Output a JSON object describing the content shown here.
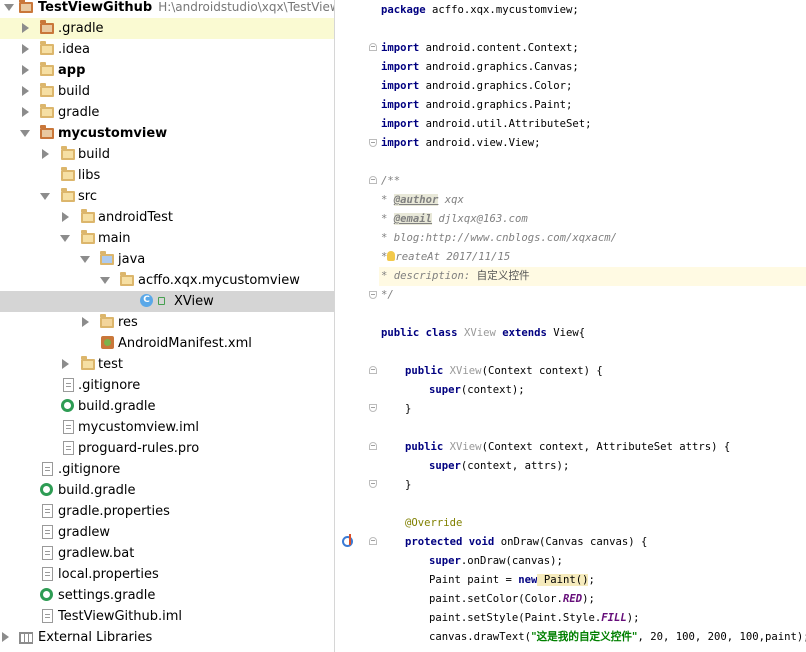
{
  "tree": {
    "root": {
      "label": "TestViewGithub",
      "path": "H:\\androidstudio\\xqx\\TestViewG"
    },
    "items": [
      {
        "label": ".gradle"
      },
      {
        "label": ".idea"
      },
      {
        "label": "app"
      },
      {
        "label": "build"
      },
      {
        "label": "gradle"
      },
      {
        "label": "mycustomview"
      },
      {
        "label": "build"
      },
      {
        "label": "libs"
      },
      {
        "label": "src"
      },
      {
        "label": "androidTest"
      },
      {
        "label": "main"
      },
      {
        "label": "java"
      },
      {
        "label": "acffo.xqx.mycustomview"
      },
      {
        "label": "XView"
      },
      {
        "label": "res"
      },
      {
        "label": "AndroidManifest.xml"
      },
      {
        "label": "test"
      },
      {
        "label": ".gitignore"
      },
      {
        "label": "build.gradle"
      },
      {
        "label": "mycustomview.iml"
      },
      {
        "label": "proguard-rules.pro"
      },
      {
        "label": ".gitignore"
      },
      {
        "label": "build.gradle"
      },
      {
        "label": "gradle.properties"
      },
      {
        "label": "gradlew"
      },
      {
        "label": "gradlew.bat"
      },
      {
        "label": "local.properties"
      },
      {
        "label": "settings.gradle"
      },
      {
        "label": "TestViewGithub.iml"
      },
      {
        "label": "External Libraries"
      }
    ]
  },
  "icons": {
    "class_badge": "C"
  },
  "code": {
    "l1": [
      "package",
      " acffo.xqx.mycustomview;"
    ],
    "imports": [
      [
        "import",
        " android.content.Context;"
      ],
      [
        "import",
        " android.graphics.Canvas;"
      ],
      [
        "import",
        " android.graphics.Color;"
      ],
      [
        "import",
        " android.graphics.Paint;"
      ],
      [
        "import",
        " android.util.AttributeSet;"
      ],
      [
        "import",
        " android.view.View;"
      ]
    ],
    "doc": {
      "open": "/**",
      "star": "* ",
      "author_tag": "@author",
      "author_val": " xqx",
      "email_tag": "@email",
      "email_val": " djlxqx@163.com",
      "blog": "* blog:http://www.cnblogs.com/xqxacm/",
      "create_pre": "*",
      "create": "reateAt 2017/11/15",
      "desc_pre": "* description: ",
      "desc": "自定义控件",
      "close": "*/"
    },
    "class_line": {
      "kw1": "public",
      "kw2": "class",
      "name": " XView ",
      "kw3": "extends",
      "rest": " View{"
    },
    "ctor1": {
      "kw": "public",
      "name": " XView",
      "rest": "(Context context) {"
    },
    "super1": {
      "kw": "super",
      "rest": "(context);"
    },
    "close_brace": "}",
    "ctor2": {
      "kw": "public",
      "name": " XView",
      "rest": "(Context context, AttributeSet attrs) {"
    },
    "super2": {
      "kw": "super",
      "rest": "(context, attrs);"
    },
    "annotation": "@Override",
    "ondraw": {
      "kw1": "protected",
      "kw2": "void",
      "rest": " onDraw(Canvas canvas) {"
    },
    "super3": {
      "kw": "super",
      "rest": ".onDraw(canvas);"
    },
    "paint_line": {
      "pre": "Paint paint = ",
      "kw": "new",
      "rest": " Paint",
      "paren": "()",
      "end": ";"
    },
    "color_line": {
      "pre": "paint.setColor(Color.",
      "cst": "RED",
      "end": ");"
    },
    "style_line": {
      "pre": "paint.setStyle(Paint.Style.",
      "cst": "FILL",
      "end": ");"
    },
    "text_line": {
      "pre": "canvas.drawText(",
      "str": "\"这是我的自定义控件\"",
      "end": ", 20, 100, 200, 100,paint);"
    }
  }
}
